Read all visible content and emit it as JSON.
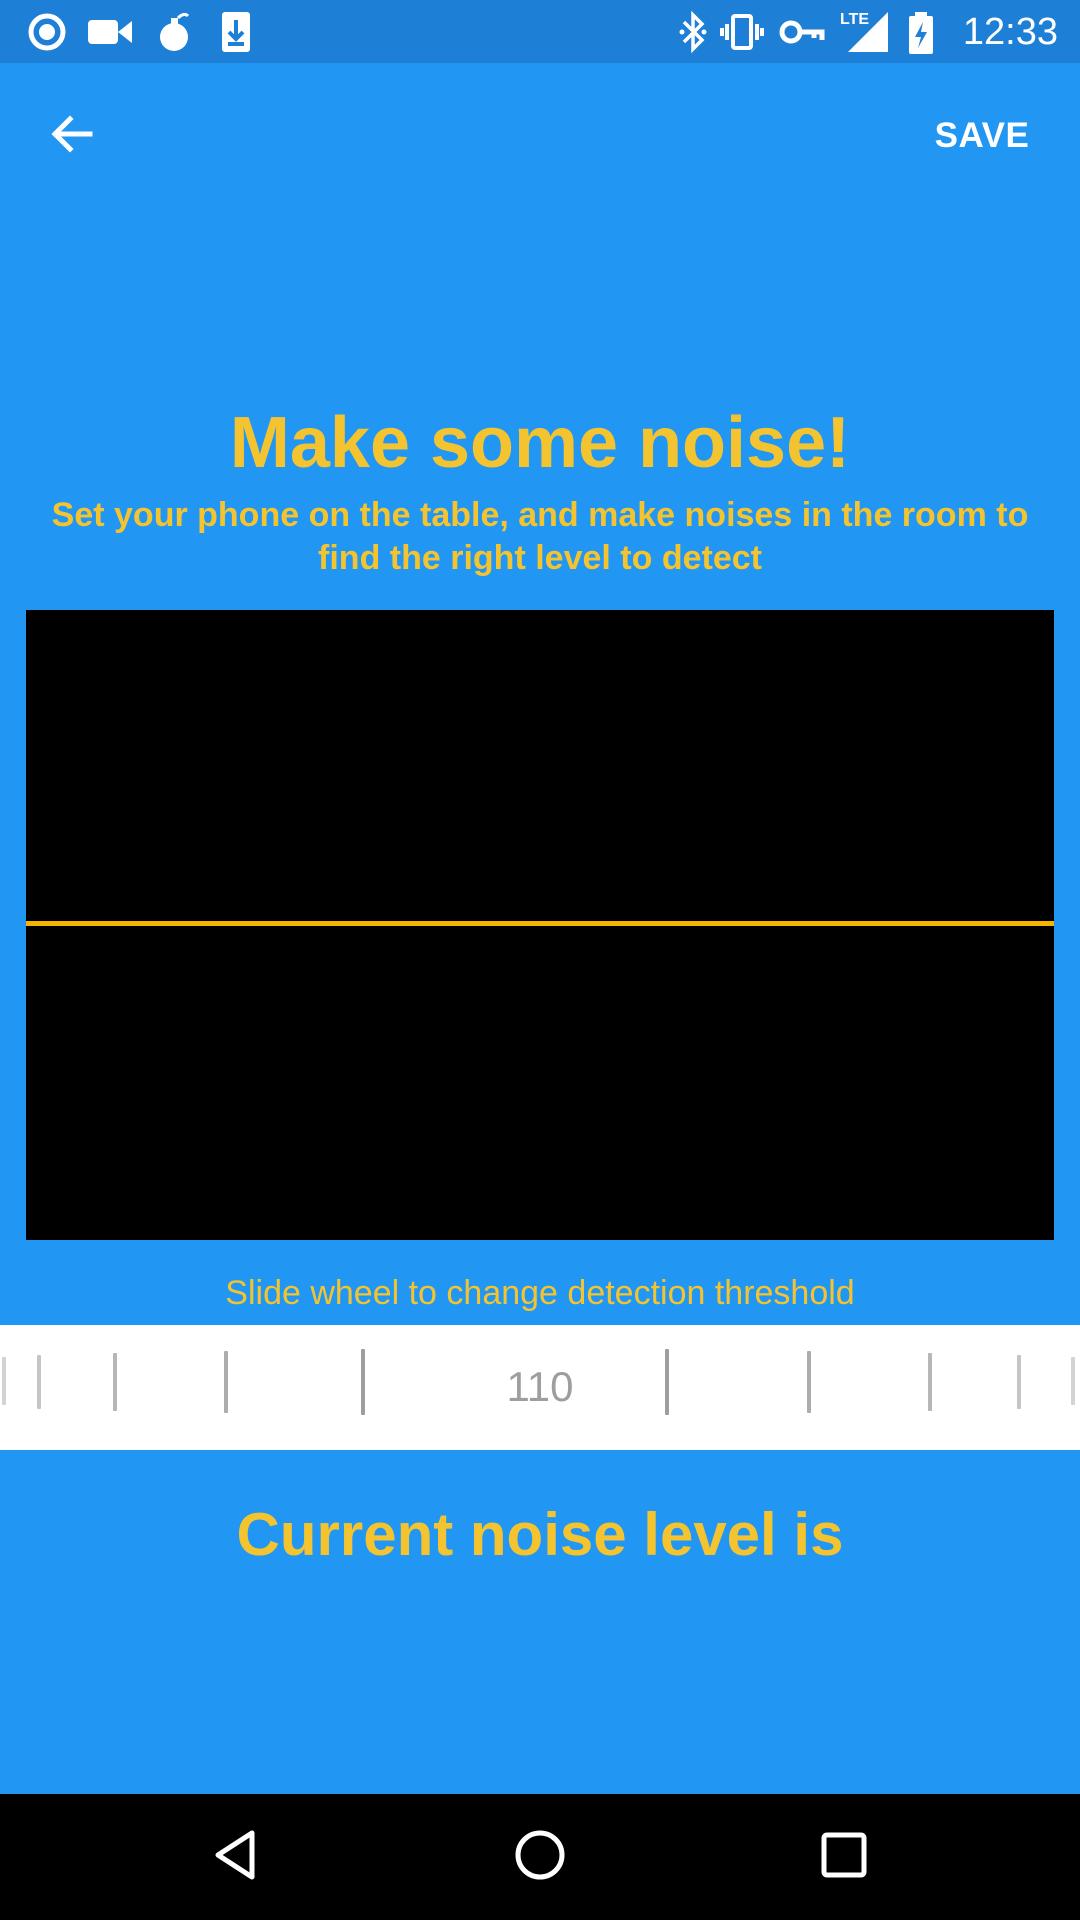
{
  "status_bar": {
    "time": "12:33",
    "left_icons": [
      "radio-button-icon",
      "video-camera-icon",
      "bomb-icon",
      "download-icon"
    ],
    "right_icons": [
      "bluetooth-icon",
      "vibrate-icon",
      "vpn-key-icon",
      "lte-signal-icon",
      "battery-charging-icon"
    ],
    "network_label": "LTE"
  },
  "toolbar": {
    "back_icon": "arrow-back-icon",
    "save_label": "SAVE"
  },
  "heading": {
    "title": "Make some noise!",
    "subtitle": "Set your phone on the table, and make noises in the room to find the right level to detect"
  },
  "visualizer": {
    "threshold_level": 0.5
  },
  "wheel": {
    "hint": "Slide wheel to change detection threshold",
    "value": "110"
  },
  "current_noise": {
    "label": "Current noise level is"
  },
  "nav_bar": {
    "icons": [
      "back-triangle-icon",
      "home-circle-icon",
      "recents-square-icon"
    ]
  },
  "colors": {
    "background": "#2196F3",
    "status_bar": "#1E7FD6",
    "accent_yellow": "#F4C430",
    "threshold_line": "#F4B400",
    "visualizer_bg": "#000000",
    "wheel_bg": "#FFFFFF",
    "tick_gray": "#9E9E9E"
  }
}
